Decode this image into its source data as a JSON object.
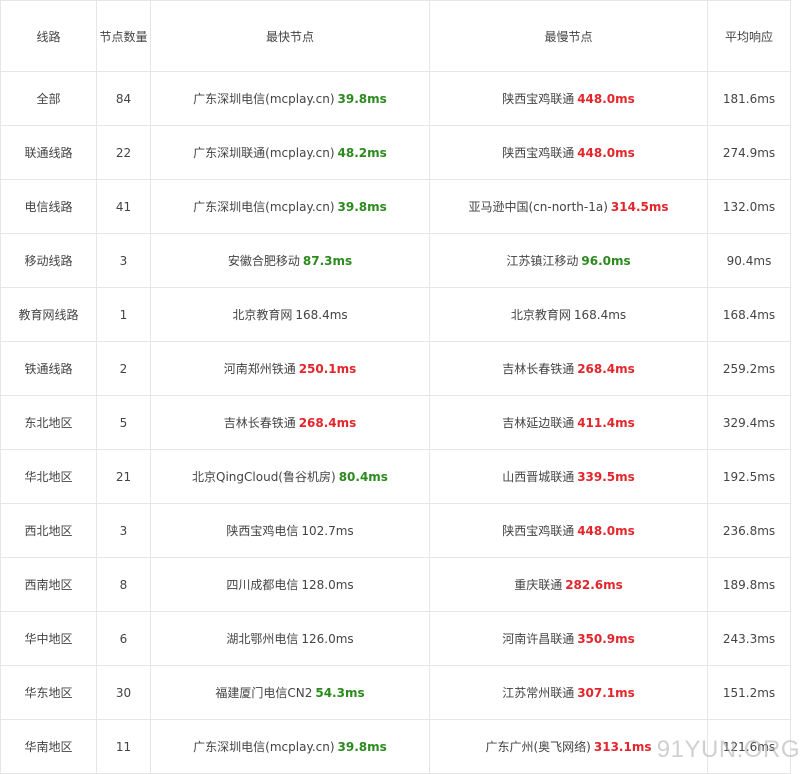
{
  "headers": [
    "线路",
    "节点数量",
    "最快节点",
    "最慢节点",
    "平均响应"
  ],
  "colors": {
    "good": "#2c8a1f",
    "bad": "#e3262c",
    "text": "#444444"
  },
  "rows": [
    {
      "line": "全部",
      "count": "84",
      "fast_node": "广东深圳电信(mcplay.cn)",
      "fast_ms": "39.8ms",
      "fast_color": "green",
      "slow_node": "陕西宝鸡联通",
      "slow_ms": "448.0ms",
      "slow_color": "red",
      "avg": "181.6ms"
    },
    {
      "line": "联通线路",
      "count": "22",
      "fast_node": "广东深圳联通(mcplay.cn)",
      "fast_ms": "48.2ms",
      "fast_color": "green",
      "slow_node": "陕西宝鸡联通",
      "slow_ms": "448.0ms",
      "slow_color": "red",
      "avg": "274.9ms"
    },
    {
      "line": "电信线路",
      "count": "41",
      "fast_node": "广东深圳电信(mcplay.cn)",
      "fast_ms": "39.8ms",
      "fast_color": "green",
      "slow_node": "亚马逊中国(cn-north-1a)",
      "slow_ms": "314.5ms",
      "slow_color": "red",
      "avg": "132.0ms"
    },
    {
      "line": "移动线路",
      "count": "3",
      "fast_node": "安徽合肥移动",
      "fast_ms": "87.3ms",
      "fast_color": "green",
      "slow_node": "江苏镇江移动",
      "slow_ms": "96.0ms",
      "slow_color": "green",
      "avg": "90.4ms"
    },
    {
      "line": "教育网线路",
      "count": "1",
      "fast_node": "北京教育网",
      "fast_ms": "168.4ms",
      "fast_color": "plain",
      "slow_node": "北京教育网",
      "slow_ms": "168.4ms",
      "slow_color": "plain",
      "avg": "168.4ms"
    },
    {
      "line": "铁通线路",
      "count": "2",
      "fast_node": "河南郑州铁通",
      "fast_ms": "250.1ms",
      "fast_color": "red",
      "slow_node": "吉林长春铁通",
      "slow_ms": "268.4ms",
      "slow_color": "red",
      "avg": "259.2ms"
    },
    {
      "line": "东北地区",
      "count": "5",
      "fast_node": "吉林长春铁通",
      "fast_ms": "268.4ms",
      "fast_color": "red",
      "slow_node": "吉林延边联通",
      "slow_ms": "411.4ms",
      "slow_color": "red",
      "avg": "329.4ms"
    },
    {
      "line": "华北地区",
      "count": "21",
      "fast_node": "北京QingCloud(鲁谷机房)",
      "fast_ms": "80.4ms",
      "fast_color": "green",
      "slow_node": "山西晋城联通",
      "slow_ms": "339.5ms",
      "slow_color": "red",
      "avg": "192.5ms"
    },
    {
      "line": "西北地区",
      "count": "3",
      "fast_node": "陕西宝鸡电信",
      "fast_ms": "102.7ms",
      "fast_color": "plain",
      "slow_node": "陕西宝鸡联通",
      "slow_ms": "448.0ms",
      "slow_color": "red",
      "avg": "236.8ms"
    },
    {
      "line": "西南地区",
      "count": "8",
      "fast_node": "四川成都电信",
      "fast_ms": "128.0ms",
      "fast_color": "plain",
      "slow_node": "重庆联通",
      "slow_ms": "282.6ms",
      "slow_color": "red",
      "avg": "189.8ms"
    },
    {
      "line": "华中地区",
      "count": "6",
      "fast_node": "湖北鄂州电信",
      "fast_ms": "126.0ms",
      "fast_color": "plain",
      "slow_node": "河南许昌联通",
      "slow_ms": "350.9ms",
      "slow_color": "red",
      "avg": "243.3ms"
    },
    {
      "line": "华东地区",
      "count": "30",
      "fast_node": "福建厦门电信CN2",
      "fast_ms": "54.3ms",
      "fast_color": "green",
      "slow_node": "江苏常州联通",
      "slow_ms": "307.1ms",
      "slow_color": "red",
      "avg": "151.2ms"
    },
    {
      "line": "华南地区",
      "count": "11",
      "fast_node": "广东深圳电信(mcplay.cn)",
      "fast_ms": "39.8ms",
      "fast_color": "green",
      "slow_node": "广东广州(奥飞网络)",
      "slow_ms": "313.1ms",
      "slow_color": "red",
      "avg": "121.6ms"
    }
  ],
  "watermark": "91YUN.ORG"
}
